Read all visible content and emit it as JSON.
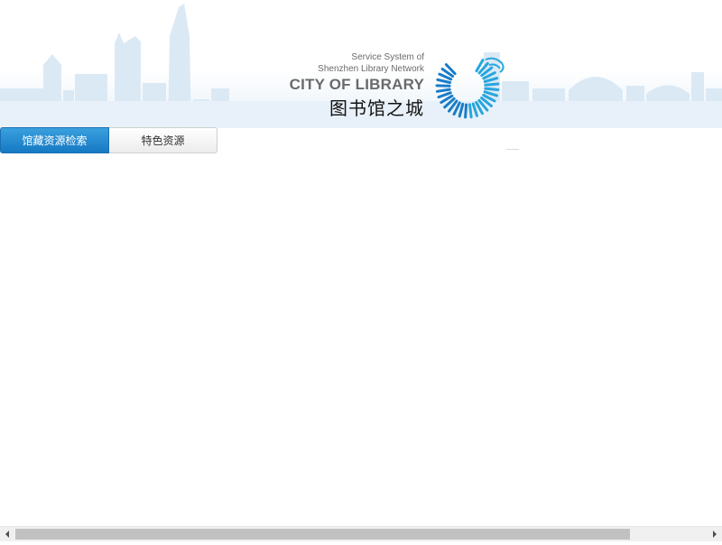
{
  "banner": {
    "logo": {
      "subtitle_line1": "Service System of",
      "subtitle_line2": "Shenzhen Library Network",
      "title_en": "CITY OF LIBRARY",
      "title_cn": "图书馆之城"
    },
    "colors": {
      "sky": "#cfe2f1",
      "logo_blue": "#1a7cc8",
      "logo_cyan": "#27a6dd"
    }
  },
  "tabs": [
    {
      "label": "馆藏资源检索",
      "active": true
    },
    {
      "label": "特色资源",
      "active": false
    }
  ],
  "scrollbar": {
    "icon_left": "arrow-left-icon",
    "icon_right": "arrow-right-icon"
  }
}
